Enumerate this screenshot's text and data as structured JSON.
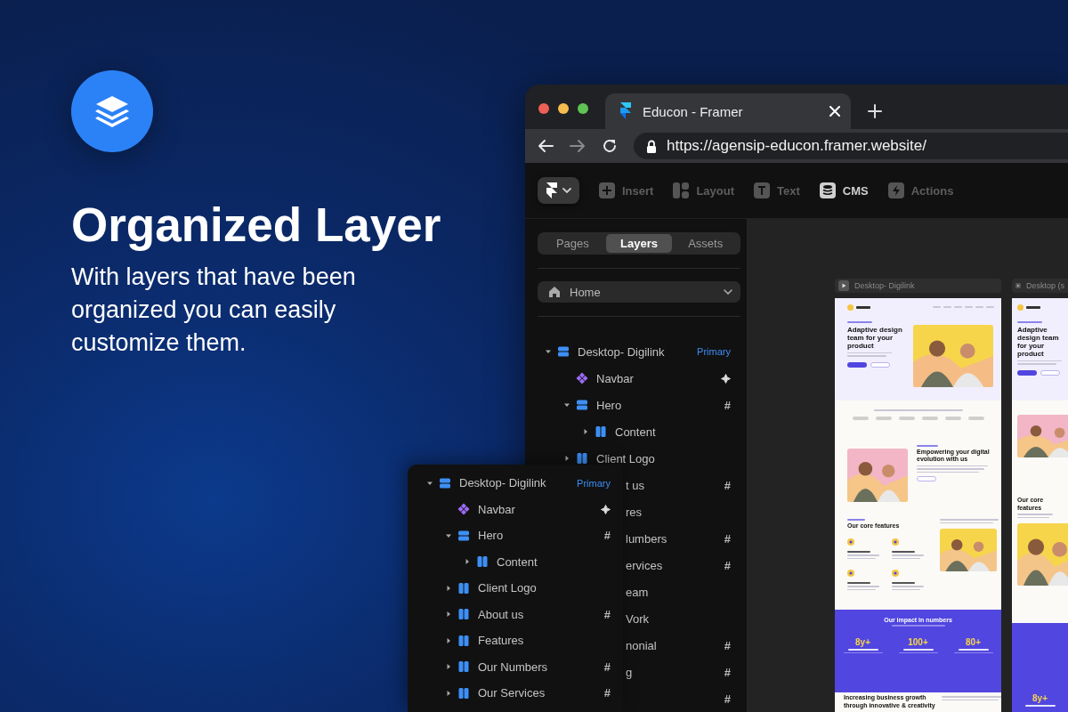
{
  "promo": {
    "title": "Organized Layer",
    "text": "With layers that have been organized you can easily customize them."
  },
  "browser": {
    "tab": {
      "title": "Educon - Framer"
    },
    "url": "https://agensip-educon.framer.website/"
  },
  "toolbar": [
    {
      "kind": "insert",
      "label": "Insert",
      "active": false
    },
    {
      "kind": "layout",
      "label": "Layout",
      "active": false
    },
    {
      "kind": "text",
      "label": "Text",
      "active": false
    },
    {
      "kind": "cms",
      "label": "CMS",
      "active": true
    },
    {
      "kind": "actions",
      "label": "Actions",
      "active": false
    }
  ],
  "sidebar": {
    "tabs": [
      {
        "label": "Pages",
        "selected": false
      },
      {
        "label": "Layers",
        "selected": true
      },
      {
        "label": "Assets",
        "selected": false
      }
    ],
    "page": "Home",
    "layers": [
      {
        "label": "Desktop- Digilink",
        "kind": "stack",
        "expanded": true,
        "badge": {
          "kind": "label",
          "text": "Primary"
        },
        "children": [
          {
            "label": "Navbar",
            "kind": "component",
            "badge": {
              "kind": "plus"
            }
          },
          {
            "label": "Hero",
            "kind": "stack",
            "expanded": true,
            "badge": {
              "kind": "hash",
              "text": "#"
            },
            "children": [
              {
                "label": "Content",
                "kind": "columns",
                "expanded": false
              }
            ]
          },
          {
            "label": "Client Logo",
            "kind": "columns",
            "expanded": false
          },
          {
            "label": "t us",
            "kind": "clipped",
            "badge": {
              "kind": "hash",
              "text": "#"
            }
          },
          {
            "label": "res",
            "kind": "clipped"
          },
          {
            "label": "lumbers",
            "kind": "clipped",
            "badge": {
              "kind": "hash",
              "text": "#"
            }
          },
          {
            "label": "ervices",
            "kind": "clipped",
            "badge": {
              "kind": "hash",
              "text": "#"
            }
          },
          {
            "label": "eam",
            "kind": "clipped"
          },
          {
            "label": "Vork",
            "kind": "clipped"
          },
          {
            "label": "nonial",
            "kind": "clipped",
            "badge": {
              "kind": "hash",
              "text": "#"
            }
          },
          {
            "label": "g",
            "kind": "clipped",
            "badge": {
              "kind": "hash",
              "text": "#"
            }
          },
          {
            "kind": "clipped",
            "badge": {
              "kind": "hash",
              "text": "#"
            }
          }
        ]
      }
    ]
  },
  "canvas": {
    "frames": [
      {
        "kind": "full",
        "label": "Desktop- Digilink",
        "headline": "Adaptive design team for your product",
        "about_title": "Empowering your digital evolution with us",
        "features_title": "Our core features",
        "impact_title": "Our impact in numbers",
        "stats": [
          "8y+",
          "100+",
          "80+"
        ],
        "services_title": "Increasing business growth through innovative & creativity"
      },
      {
        "kind": "narrow",
        "label": "Desktop (s",
        "headline": "Adaptive design team for your product",
        "features_title": "Our core features",
        "stats": [
          "8y+"
        ]
      }
    ]
  },
  "layers_popout": [
    {
      "label": "Desktop- Digilink",
      "kind": "stack",
      "expanded": true,
      "badge": {
        "kind": "label",
        "text": "Primary"
      },
      "children": [
        {
          "label": "Navbar",
          "kind": "component",
          "badge": {
            "kind": "plus"
          }
        },
        {
          "label": "Hero",
          "kind": "stack",
          "expanded": true,
          "badge": {
            "kind": "hash",
            "text": "#"
          },
          "children": [
            {
              "label": "Content",
              "kind": "columns",
              "expanded": false
            }
          ]
        },
        {
          "label": "Client Logo",
          "kind": "columns",
          "expanded": false
        },
        {
          "label": "About us",
          "kind": "columns",
          "expanded": false,
          "badge": {
            "kind": "hash",
            "text": "#"
          }
        },
        {
          "label": "Features",
          "kind": "columns",
          "expanded": false
        },
        {
          "label": "Our Numbers",
          "kind": "columns",
          "expanded": false,
          "badge": {
            "kind": "hash",
            "text": "#"
          }
        },
        {
          "label": "Our Services",
          "kind": "columns",
          "expanded": false,
          "badge": {
            "kind": "hash",
            "text": "#"
          }
        }
      ]
    }
  ]
}
